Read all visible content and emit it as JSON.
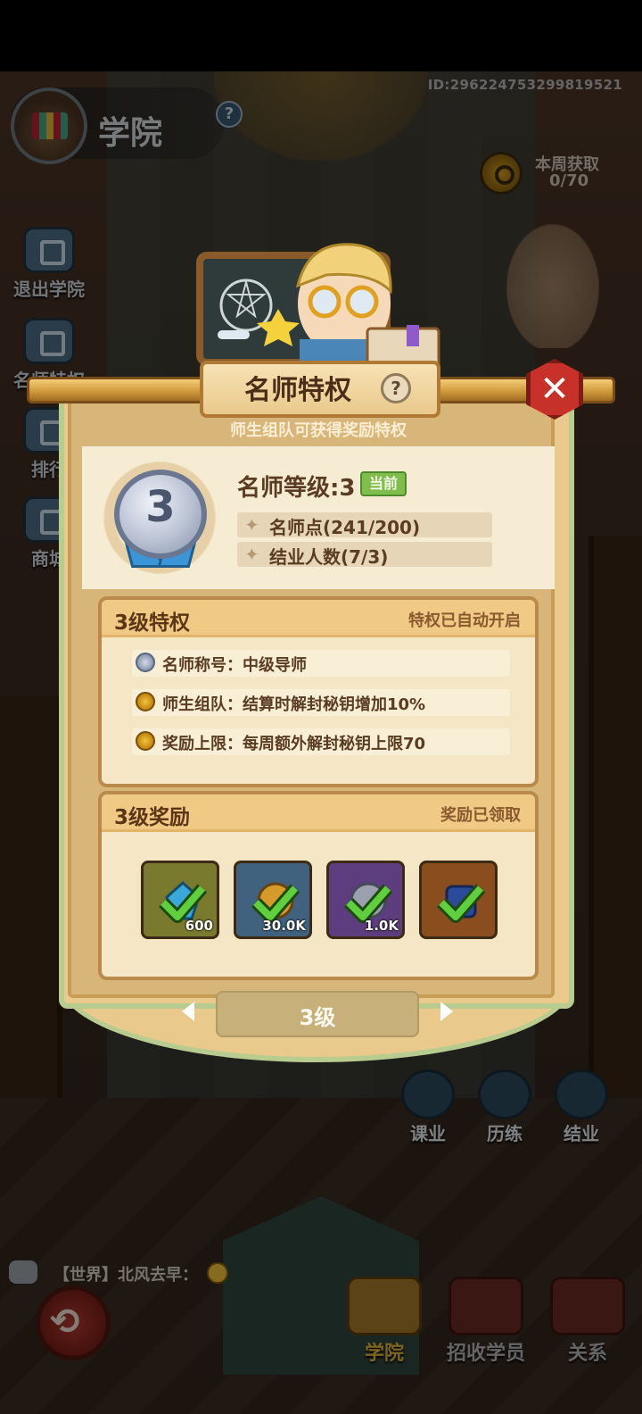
{
  "account": {
    "id_text": "ID:2962247532998195​21"
  },
  "header": {
    "title": "学院",
    "help": "?"
  },
  "weekly": {
    "label": "本周获取",
    "value": "0/70"
  },
  "side_menu": [
    {
      "label": "退出学院"
    },
    {
      "label": "名师特权"
    },
    {
      "label": "排行"
    },
    {
      "label": "商城"
    }
  ],
  "modal": {
    "title": "名师特权",
    "help": "?",
    "close": "✕",
    "subtitle": "师生组队可获得奖励特权",
    "level_card": {
      "medal_level": "3",
      "title": "名师等级:3",
      "current_badge": "当前",
      "points": "名师点(241/200)",
      "graduates": "结业人数(7/3)"
    },
    "privileges": {
      "heading": "3级特权",
      "status": "特权已自动开启",
      "items": [
        {
          "text": "名师称号：中级导师",
          "icon": "medal-icon"
        },
        {
          "text": "师生组队：结算时解封秘钥增加10%",
          "icon": "key-icon"
        },
        {
          "text": "奖励上限：每周额外解封秘钥上限70",
          "icon": "key-icon"
        }
      ]
    },
    "rewards": {
      "heading": "3级奖励",
      "status": "奖励已领取",
      "items": [
        {
          "qty": "600",
          "icon": "blue-crystal-icon",
          "bg": "#7a7a2e"
        },
        {
          "qty": "30.0K",
          "icon": "gold-coin-icon",
          "bg": "#40627f"
        },
        {
          "qty": "1.0K",
          "icon": "silver-orb-icon",
          "bg": "#5d3d7d"
        },
        {
          "qty": "",
          "icon": "blue-armor-icon",
          "bg": "#8a4e1e"
        }
      ]
    },
    "level_selector": {
      "value": "3级"
    }
  },
  "actions": [
    {
      "label": "课业"
    },
    {
      "label": "历练"
    },
    {
      "label": "结业"
    }
  ],
  "chat": {
    "message": "【世界】北风去早："
  },
  "bottom_nav": [
    {
      "label": "学院",
      "color": "#e0b43c"
    },
    {
      "label": "招收学员",
      "color": "#b9b9b9"
    },
    {
      "label": "关系",
      "color": "#b9b9b9"
    }
  ],
  "colors": {
    "accent_gold": "#e0b43c",
    "close_red": "#c8312a",
    "current_green": "#7fbd4d"
  }
}
